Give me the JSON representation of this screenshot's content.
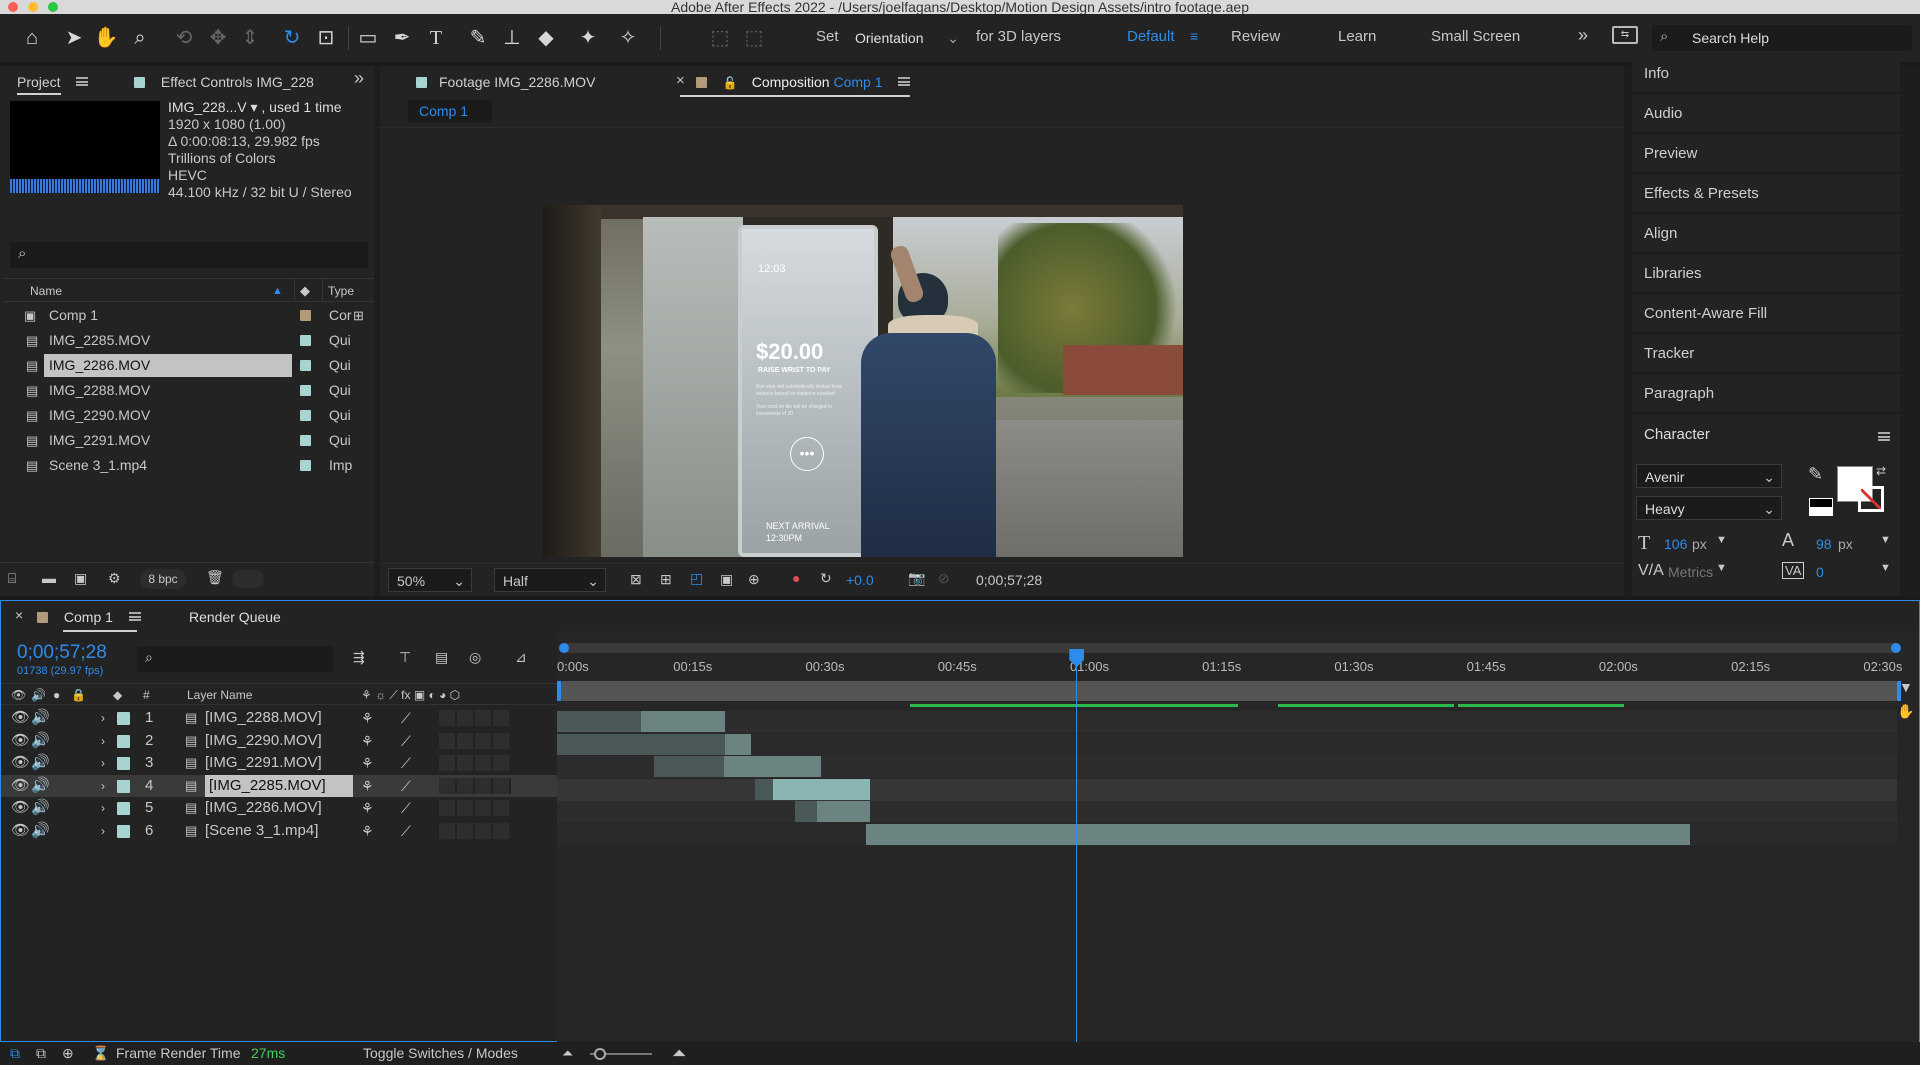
{
  "window": {
    "title": "Adobe After Effects 2022 - /Users/joelfagans/Desktop/Motion Design Assets/intro footage.aep"
  },
  "toolbar": {
    "set_label": "Set",
    "orientation_value": "Orientation",
    "for3d_label": "for 3D layers",
    "workspaces": [
      "Default",
      "Review",
      "Learn",
      "Small Screen"
    ],
    "search_placeholder": "Search Help",
    "accent": "#2d8ceb"
  },
  "project_panel": {
    "tab_project": "Project",
    "tab_effect_controls": "Effect Controls IMG_228",
    "info_name": "IMG_228...V ▾ , used 1 time",
    "info_lines": [
      "1920 x 1080 (1.00)",
      "Δ 0:00:08:13, 29.982 fps",
      "Trillions of Colors",
      "HEVC",
      "44.100 kHz / 32 bit U / Stereo"
    ],
    "col_name": "Name",
    "col_type": "Type",
    "items": [
      {
        "name": "Comp 1",
        "type": "Cor"
      },
      {
        "name": "IMG_2285.MOV",
        "type": "Qui"
      },
      {
        "name": "IMG_2286.MOV",
        "type": "Qui"
      },
      {
        "name": "IMG_2288.MOV",
        "type": "Qui"
      },
      {
        "name": "IMG_2290.MOV",
        "type": "Qui"
      },
      {
        "name": "IMG_2291.MOV",
        "type": "Qui"
      },
      {
        "name": "Scene 3_1.mp4",
        "type": "Imp"
      }
    ],
    "bpc": "8 bpc"
  },
  "viewer": {
    "tab_footage": "Footage IMG_2286.MOV",
    "tab_comp_prefix": "Composition",
    "tab_comp_name": "Comp 1",
    "breadcrumb": "Comp 1",
    "zoom": "50%",
    "resolution": "Half",
    "exposure": "+0.0",
    "timecode": "0;00;57;28",
    "kiosk_time": "12:03",
    "kiosk_amount": "$20.00",
    "kiosk_sub": "RAISE WRIST TO PAY",
    "kiosk_note1": "Bus stop will automatically deduct from balance based on distance traveled",
    "kiosk_note2": "Your card on file will be charged in increments of 20",
    "kiosk_arrival": "NEXT ARRIVAL",
    "kiosk_arrival_time": "12:30PM"
  },
  "right_panels": [
    "Info",
    "Audio",
    "Preview",
    "Effects & Presets",
    "Align",
    "Libraries",
    "Content-Aware Fill",
    "Tracker",
    "Paragraph"
  ],
  "character": {
    "title": "Character",
    "font": "Avenir",
    "style": "Heavy",
    "size": "106",
    "size_unit": "px",
    "leading": "98",
    "leading_unit": "px",
    "kerning": "Metrics",
    "tracking": "0"
  },
  "timeline": {
    "tab_comp": "Comp 1",
    "tab_render": "Render Queue",
    "timecode": "0;00;57;28",
    "frames": "01738 (29.97 fps)",
    "col_num": "#",
    "col_layer": "Layer Name",
    "ruler": [
      "0:00s",
      "00:15s",
      "00:30s",
      "00:45s",
      "01:00s",
      "01:15s",
      "01:30s",
      "01:45s",
      "02:00s",
      "02:15s",
      "02:30s"
    ],
    "layers": [
      {
        "num": "1",
        "name": "[IMG_2288.MOV]",
        "start": 0,
        "end": 19,
        "inner": 9.5
      },
      {
        "num": "2",
        "name": "[IMG_2290.MOV]",
        "start": 0,
        "end": 22,
        "inner": 19
      },
      {
        "num": "3",
        "name": "[IMG_2291.MOV]",
        "start": 11,
        "end": 30,
        "inner": 19
      },
      {
        "num": "4",
        "name": "[IMG_2285.MOV]",
        "start": 22.5,
        "end": 35.5,
        "inner": 24.5
      },
      {
        "num": "5",
        "name": "[IMG_2286.MOV]",
        "start": 27,
        "end": 35.5,
        "inner": 29.5
      },
      {
        "num": "6",
        "name": "[Scene 3_1.mp4]",
        "start": 35,
        "end": 128.5,
        "inner": 35
      }
    ],
    "playhead_seconds": 58.9,
    "duration_seconds": 152,
    "render_time_label": "Frame Render Time",
    "render_time": "27ms",
    "toggle_label": "Toggle Switches / Modes"
  }
}
